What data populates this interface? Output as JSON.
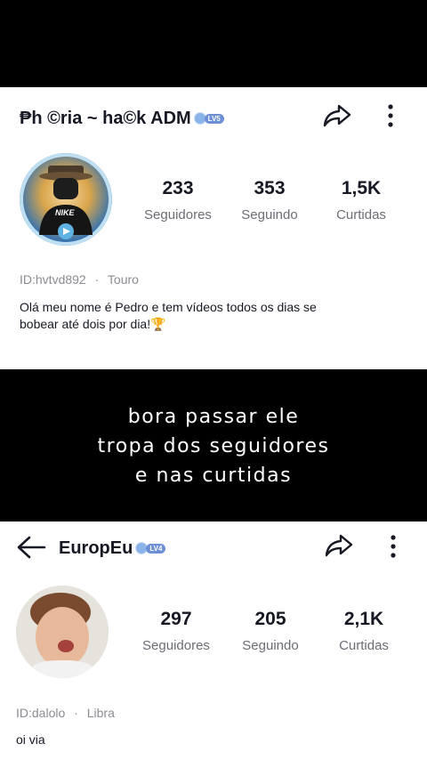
{
  "profile1": {
    "username": "₱h ©ria ~ ha©k ADM",
    "level": "LV5",
    "stats": [
      {
        "value": "233",
        "label": "Seguidores"
      },
      {
        "value": "353",
        "label": "Seguindo"
      },
      {
        "value": "1,5K",
        "label": "Curtidas"
      }
    ],
    "user_id": "ID:hvtvd892",
    "sign": "Touro",
    "bio_line1": "Olá meu nome é Pedro e tem vídeos todos os dias se",
    "bio_line2": "bobear até dois por dia!🏆",
    "avatar_shirt_text": "NIKE"
  },
  "caption": {
    "line1": "bora passar ele",
    "line2": "tropa dos seguidores",
    "line3": "e nas curtidas"
  },
  "profile2": {
    "username": "EuropEu",
    "level": "LV4",
    "stats": [
      {
        "value": "297",
        "label": "Seguidores"
      },
      {
        "value": "205",
        "label": "Seguindo"
      },
      {
        "value": "2,1K",
        "label": "Curtidas"
      }
    ],
    "user_id": "ID:dalolo",
    "sign": "Libra",
    "bio": "oi via"
  },
  "separator": "·"
}
